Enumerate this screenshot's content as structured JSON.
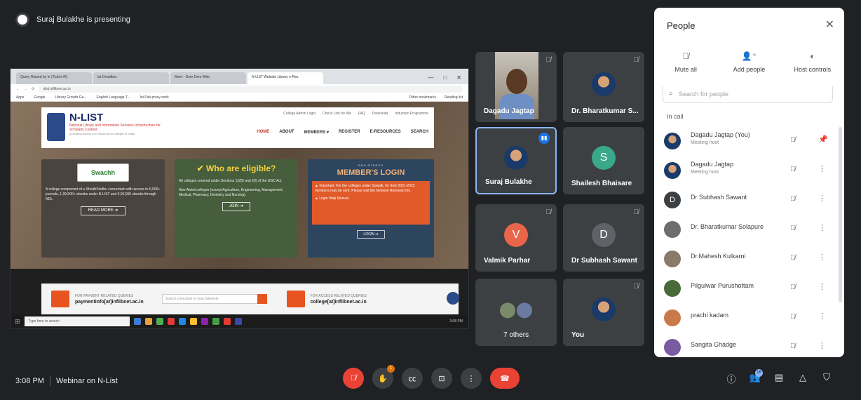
{
  "presenter": {
    "text": "Suraj Bulakhe is presenting"
  },
  "shared_screen": {
    "browser_tabs": [
      "Query Raised by ln (Ticket #6)",
      "lqt Gmailbox",
      "Meet - Gom Dem Web",
      "N-LIST Website Library e-Res"
    ],
    "window_controls": [
      "—",
      "□",
      "✕"
    ],
    "address": "nlist.inflibnet.ac.in",
    "bookmarks": [
      "Apps",
      "Google",
      "Library Growth Ga...",
      "English Language T...",
      "Ini Pub proxy work"
    ],
    "bookmarks_right": [
      "Other bookmarks",
      "Reading list"
    ],
    "site": {
      "logo_name": "N-LIST",
      "logo_sub": "National Library and Information Services Infrastructure for Scholarly Content",
      "logo_sub2": "(providing access to e-resources to colleges in India)",
      "util_links": [
        "College Admin Login",
        "Check Link for We",
        "FAQ",
        "Download",
        "Induction Programme"
      ],
      "nav": [
        "HOME",
        "ABOUT",
        "MEMBERS ▾",
        "REGISTER",
        "E-RESOURCES",
        "SEARCH"
      ],
      "left_card_logo": "Swachh",
      "left_card_text": "A college component of e-ShodhSindhu consortium with access to 6,000+ journals, 1,99,500+ ebooks under N-LIST and 6,00,000 ebooks through NDL.",
      "left_card_button": "READ MORE ➜",
      "mid_card_title": "✔ Who are eligible?",
      "mid_card_item1": "All colleges covered under Sections 12(B) and 2(f) of the UGC Act.",
      "mid_card_item2": "Non-Aided colleges (except Agriculture, Engineering, Management, Medical, Pharmacy, Dentistry and Nursing).",
      "mid_card_button": "JOIN ➜",
      "right_card_small": "REGISTERED",
      "right_card_title": "MEMBER'S LOGIN",
      "right_card_alert": "▲ Important: For the colleges under Sowalk, for their 2021-2022 members may be sent. Please visit the Network Renewal Info.",
      "right_card_alert2": "▲ Login Help Manual",
      "right_card_button": "LOGIN ➜",
      "footer_payment_label": "FOR PAYMENT RELATED QUERIES",
      "footer_payment_email": "paymentinfo[at]inflibnet.ac.in",
      "footer_search": "Search a location or your interests",
      "footer_access_label": "FOR ACCESS RELATED QUERIES",
      "footer_access_email": "college[at]inflibnet.ac.in"
    },
    "taskbar_search": "Type here to search",
    "taskbar_time": "3:08 PM"
  },
  "tiles": [
    {
      "name": "Dagadu Jagtap"
    },
    {
      "name": "Dr. Bharatkumar S..."
    },
    {
      "name": "Suraj Bulakhe"
    },
    {
      "name": "Shailesh Bhaisare",
      "initial": "S"
    },
    {
      "name": "Valmik Parhar",
      "initial": "V"
    },
    {
      "name": "Dr Subhash Sawant",
      "initial": "D"
    },
    {
      "name": "7 others"
    },
    {
      "name": "You"
    }
  ],
  "people_panel": {
    "title": "People",
    "close_icon": "✕",
    "actions": [
      {
        "icon": "mic-off",
        "label": "Mute all"
      },
      {
        "icon": "add-person",
        "label": "Add people"
      },
      {
        "icon": "toggle",
        "label": "Host controls"
      }
    ],
    "search_placeholder": "Search for people",
    "section_label": "In call",
    "participants": [
      {
        "name": "Dagadu Jagtap (You)",
        "role": "Meeting host",
        "initial": "",
        "color": "#5b7fb0"
      },
      {
        "name": "Dagadu Jagtap",
        "role": "Meeting host",
        "initial": "",
        "color": "#5b7fb0"
      },
      {
        "name": "Dr Subhash Sawant",
        "role": "",
        "initial": "D",
        "color": "#3c4043"
      },
      {
        "name": "Dr. Bharatkumar Solapure",
        "role": "",
        "initial": "",
        "color": "#6d6d6d"
      },
      {
        "name": "Dr.Mahesh Kulkarni",
        "role": "",
        "initial": "",
        "color": "#8a7a6a"
      },
      {
        "name": "Pilgulwar Purushottam",
        "role": "",
        "initial": "",
        "color": "#4a6a3a"
      },
      {
        "name": "prachi kadam",
        "role": "",
        "initial": "",
        "color": "#c87a4a"
      },
      {
        "name": "Sangita Ghadge",
        "role": "",
        "initial": "",
        "color": "#7a5aa0"
      }
    ]
  },
  "bottom_bar": {
    "time": "3:08 PM",
    "meeting_name": "Webinar on N-List",
    "raise_badge": "1",
    "people_count": "16"
  },
  "colors": {
    "accent": "#8ab4f8",
    "danger": "#ea4335",
    "background": "#202124"
  }
}
